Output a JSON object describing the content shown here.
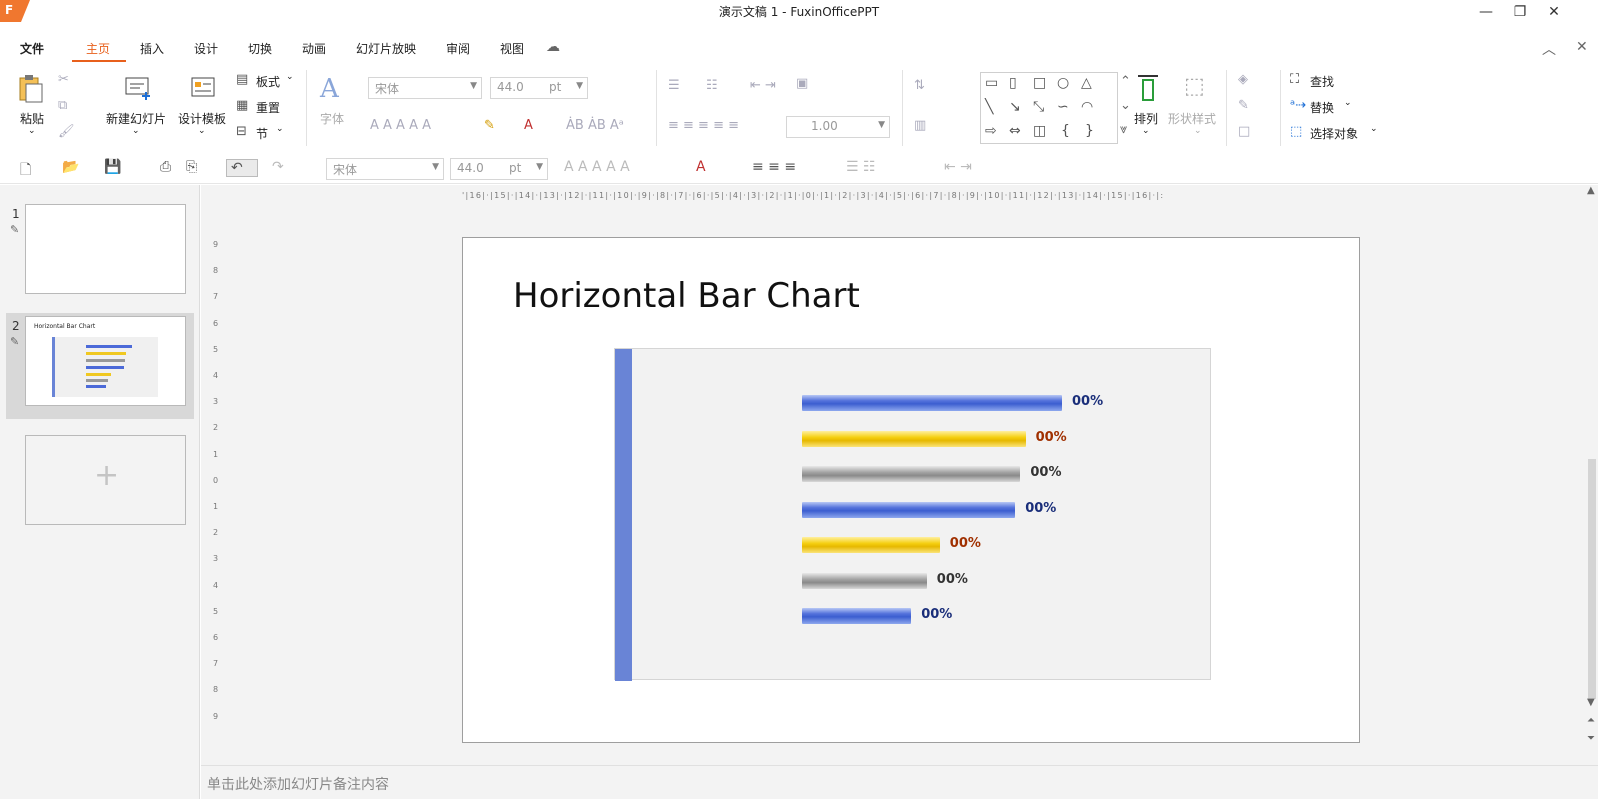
{
  "window": {
    "logo_text": "F",
    "title": "演示文稿 1 - FuxinOfficePPT",
    "minimize": "—",
    "restore": "❐",
    "close": "✕"
  },
  "menu": {
    "items": [
      "文件",
      "主页",
      "插入",
      "设计",
      "切换",
      "动画",
      "幻灯片放映",
      "审阅",
      "视图"
    ],
    "active_index": 1,
    "collapse": "︿",
    "close_doc": "✕"
  },
  "ribbon": {
    "paste": "粘贴",
    "new_slide": "新建幻灯片",
    "design_template": "设计模板",
    "layout": "板式",
    "reset": "重置",
    "section": "节",
    "font_group": "字体",
    "font_name": "宋体",
    "font_size": "44.0",
    "font_unit": "pt",
    "line_spacing": "1.00",
    "arrange": "排列",
    "shape_style": "形状样式",
    "find": "查找",
    "replace": "替换",
    "select_object": "选择对象"
  },
  "quickbar": {
    "font_name": "宋体",
    "font_size": "44.0",
    "font_unit": "pt"
  },
  "slides_panel": {
    "slides": [
      {
        "number": "1"
      },
      {
        "number": "2",
        "thumb_title": "Horizontal Bar Chart"
      }
    ],
    "add_symbol": "+"
  },
  "ruler": {
    "horizontal": "'|16|·|15|·|14|·|13|·|12|·|11|·|10|·|9|·|8|·|7|·|6|·|5|·|4|·|3|·|2|·|1|·|0|·|1|·|2|·|3|·|4|·|5|·|6|·|7|·|8|·|9|·|10|·|11|·|12|·|13|·|14|·|15|·|16|·|:",
    "vertical": [
      "9",
      "8",
      "7",
      "6",
      "5",
      "4",
      "3",
      "2",
      "1",
      "0",
      "1",
      "2",
      "3",
      "4",
      "5",
      "6",
      "7",
      "8",
      "9"
    ]
  },
  "slide": {
    "title": "Horizontal Bar Chart"
  },
  "chart_data": {
    "type": "bar",
    "orientation": "horizontal",
    "bars": [
      {
        "value": 100,
        "label": "00%",
        "color": "blue"
      },
      {
        "value": 86,
        "label": "00%",
        "color": "gold"
      },
      {
        "value": 84,
        "label": "00%",
        "color": "gray"
      },
      {
        "value": 82,
        "label": "00%",
        "color": "blue"
      },
      {
        "value": 53,
        "label": "00%",
        "color": "gold"
      },
      {
        "value": 48,
        "label": "00%",
        "color": "gray"
      },
      {
        "value": 42,
        "label": "00%",
        "color": "blue"
      }
    ],
    "colors": {
      "blue": "#3c5ed0",
      "gold": "#f5cf10",
      "gray": "#a2a2a2",
      "accent": "#6984d6"
    },
    "label_colors": {
      "blue": "#1a2e7a",
      "gold": "#a03000",
      "gray": "#333333"
    },
    "xlim": [
      0,
      100
    ]
  },
  "notes": {
    "placeholder": "单击此处添加幻灯片备注内容"
  }
}
